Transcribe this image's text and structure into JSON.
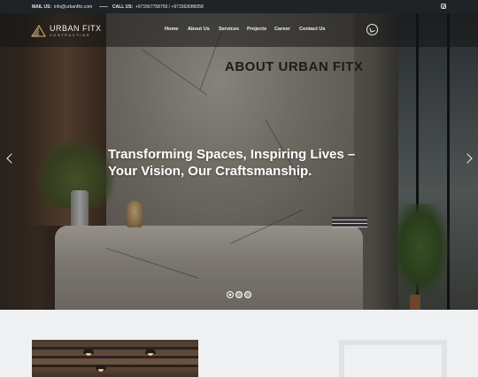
{
  "topbar": {
    "mail_label": "MAIL US:",
    "mail_value": "info@urbanfitx.com",
    "call_label": "CALL US:",
    "call_value": "+971567758759 / +971563086058"
  },
  "brand": {
    "name": "URBAN FITX",
    "tagline": "CONTRACTING"
  },
  "nav": {
    "items": [
      {
        "label": "Home"
      },
      {
        "label": "About Us"
      },
      {
        "label": "Services"
      },
      {
        "label": "Projects"
      },
      {
        "label": "Career"
      },
      {
        "label": "Contact Us"
      }
    ]
  },
  "hero": {
    "headline_line1": "Transforming Spaces, Inspiring Lives –",
    "headline_line2": "Your Vision, Our Craftsmanship.",
    "slide_count": 3,
    "active_slide": 1
  },
  "about": {
    "title": "ABOUT URBAN FITX"
  },
  "icons": {
    "social": "instagram-icon",
    "contact": "whatsapp-icon",
    "prev": "chevron-left-icon",
    "next": "chevron-right-icon"
  }
}
